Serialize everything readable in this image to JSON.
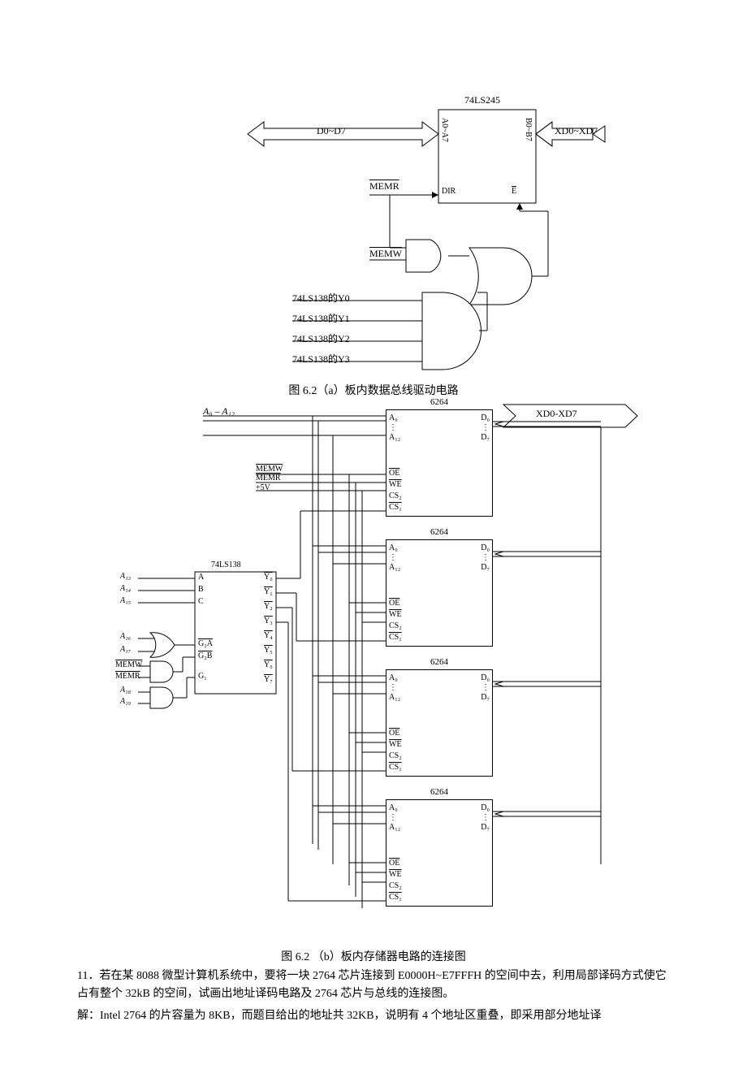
{
  "diagram_a": {
    "chip_label": "74LS245",
    "port_left": "A0~A7",
    "port_right": "B0~B7",
    "pin_dir": "DIR",
    "pin_e": "E",
    "bus_left": "D0~D7",
    "bus_right": "XD0~XD7",
    "sig_memr": "MEMR",
    "sig_memw": "MEMW",
    "y_labels": [
      "74LS138的Y0",
      "74LS138的Y1",
      "74LS138的Y2",
      "74LS138的Y3"
    ],
    "caption": "图 6.2（a）板内数据总线驱动电路"
  },
  "diagram_b": {
    "addr_bus": "A₀ – A₁₂",
    "data_bus": "XD0-XD7",
    "sig_memw": "MEMW",
    "sig_memr": "MEMR",
    "vcc": "+5V",
    "decoder": {
      "label": "74LS138",
      "inputs_top": [
        "A",
        "B",
        "C"
      ],
      "addr_top": [
        "A₁₃",
        "A₁₄",
        "A₁₅"
      ],
      "g_pins": [
        "G₂A",
        "G₂B",
        "G₁"
      ],
      "addr_g": [
        "A₁₆",
        "A₁₇",
        "A₁₈",
        "A₁₉"
      ],
      "sig_memw": "MEMW",
      "sig_memr": "MEMR",
      "outputs": [
        "Y₀",
        "Y₁",
        "Y₂",
        "Y₃",
        "Y₄",
        "Y₅",
        "Y₆",
        "Y₇"
      ]
    },
    "chip6264": {
      "label": "6264",
      "pins_left": [
        "A₀",
        "⋮",
        "A₁₂",
        "OE",
        "WE",
        "CS₂",
        "CS₁"
      ],
      "pins_right": [
        "D₀",
        "⋮",
        "D₇"
      ]
    },
    "caption": "图 6.2 （b）板内存储器电路的连接图"
  },
  "problem": {
    "number": "11．",
    "text": "若在某 8088 微型计算机系统中，要将一块 2764 芯片连接到 E0000H~E7FFFH 的空间中去，利用局部译码方式使它占有整个 32kB 的空间，试画出地址译码电路及 2764 芯片与总线的连接图。"
  },
  "solution": {
    "prefix": "解：",
    "text": "Intel 2764 的片容量为 8KB，而题目给出的地址共 32KB，说明有 4 个地址区重叠，即采用部分地址译"
  }
}
